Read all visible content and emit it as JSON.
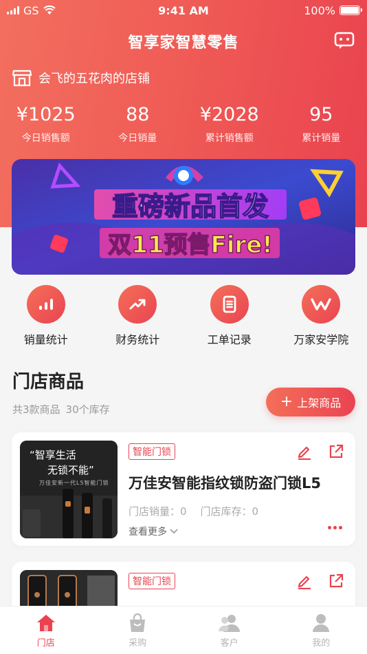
{
  "status_bar": {
    "carrier": "GS",
    "time": "9:41 AM",
    "battery": "100%"
  },
  "app": {
    "title": "智享家智慧零售"
  },
  "store": {
    "name": "会飞的五花肉的店铺"
  },
  "stats": [
    {
      "value": "¥1025",
      "label": "今日销售额"
    },
    {
      "value": "88",
      "label": "今日销量"
    },
    {
      "value": "¥2028",
      "label": "累计销售额"
    },
    {
      "value": "95",
      "label": "累计销量"
    }
  ],
  "banner": {
    "line1": "重磅新品首发",
    "line2": "双11预售Fire!"
  },
  "shortcuts": [
    {
      "label": "销量统计",
      "icon": "bar-chart-icon"
    },
    {
      "label": "财务统计",
      "icon": "trend-icon"
    },
    {
      "label": "工单记录",
      "icon": "document-icon"
    },
    {
      "label": "万家安学院",
      "icon": "w-logo-icon"
    }
  ],
  "section": {
    "title": "门店商品",
    "count": "共3款商品",
    "stock": "30个库存",
    "add_button": "上架商品"
  },
  "products": [
    {
      "tag": "智能门锁",
      "name": "万佳安智能指纹锁防盗门锁L5",
      "sales": "门店销量：0",
      "stock": "门店库存：0",
      "more": "查看更多",
      "thumb_line1": "“智享生活",
      "thumb_line2": "无锁不能”",
      "thumb_line3": "万佳安新一代L5智能门锁"
    },
    {
      "tag": "智能门锁"
    }
  ],
  "tabs": [
    {
      "label": "门店",
      "icon": "home-icon",
      "active": true
    },
    {
      "label": "采购",
      "icon": "bag-icon",
      "active": false
    },
    {
      "label": "客户",
      "icon": "customers-icon",
      "active": false
    },
    {
      "label": "我的",
      "icon": "profile-icon",
      "active": false
    }
  ],
  "colors": {
    "accent": "#e9434f",
    "header_start": "#f36f5f",
    "header_end": "#e9424f"
  }
}
